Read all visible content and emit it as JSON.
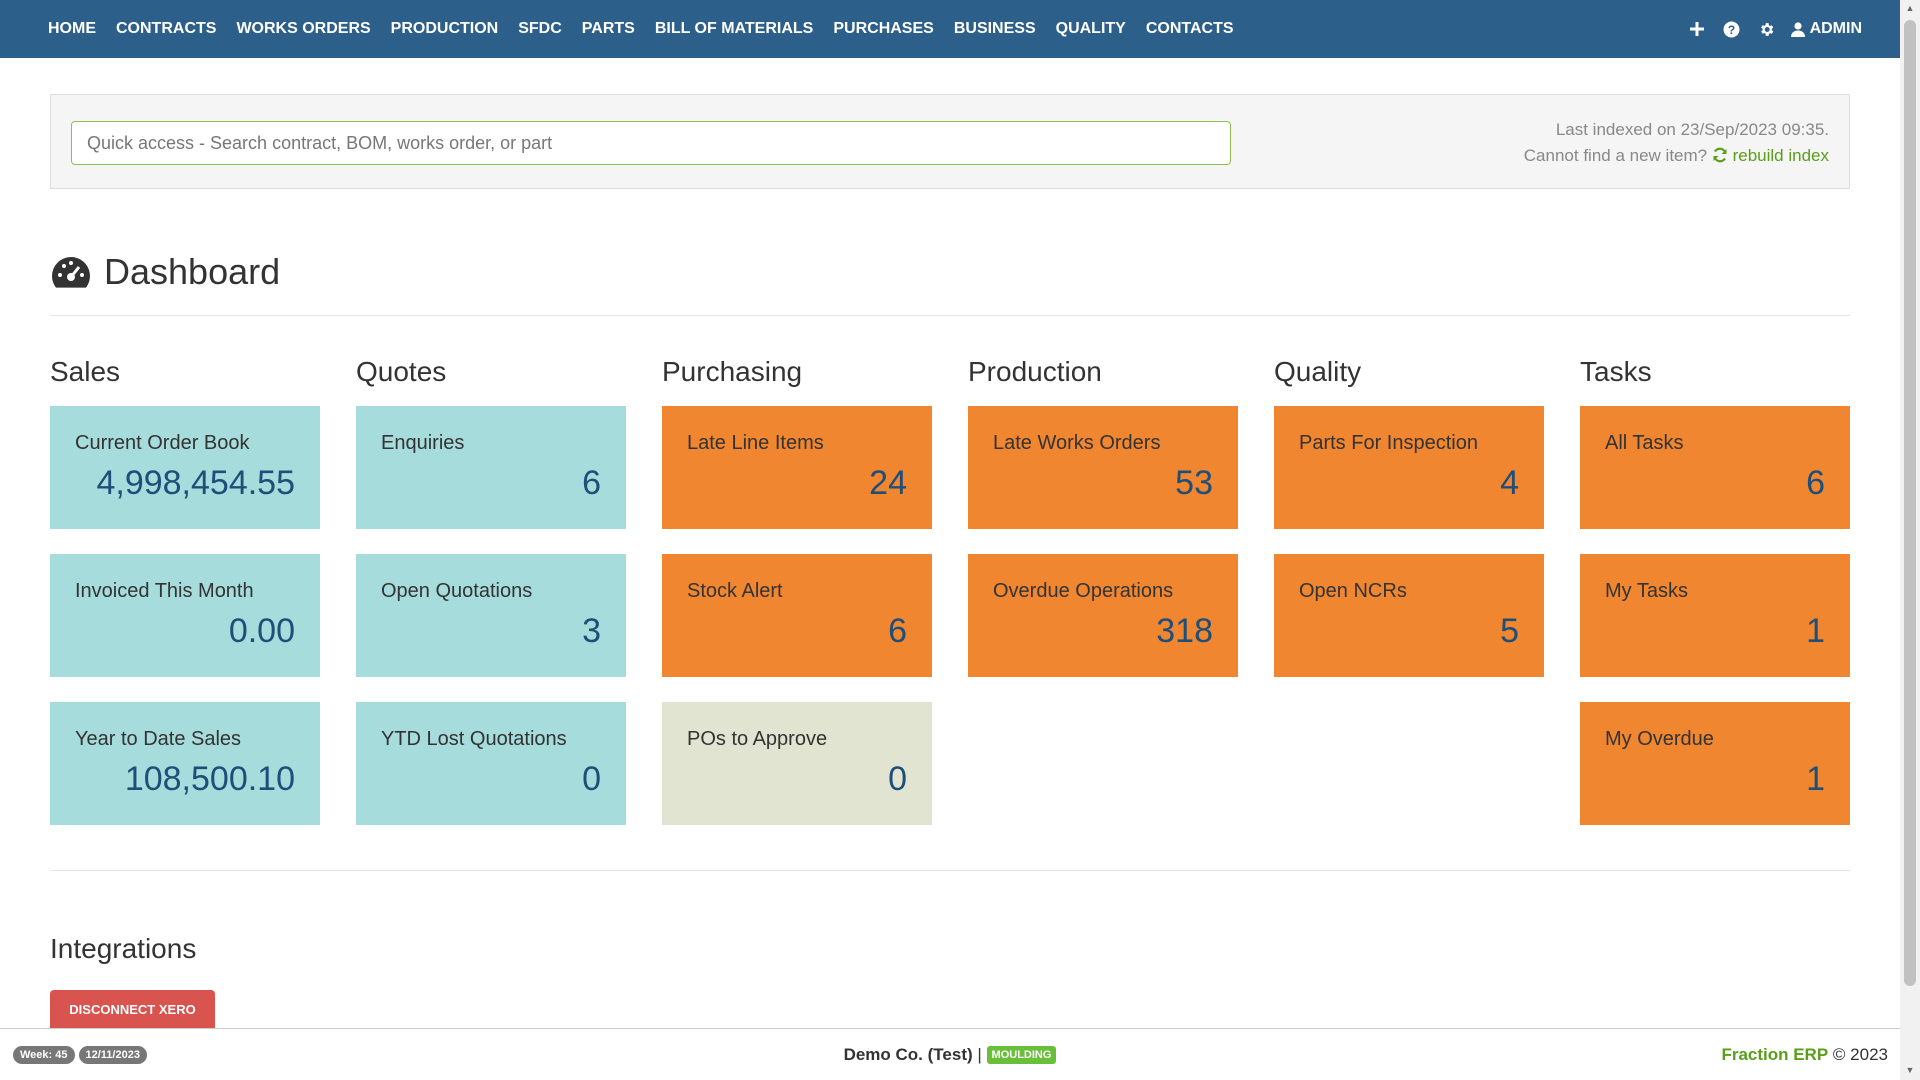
{
  "nav": {
    "items": [
      "HOME",
      "CONTRACTS",
      "WORKS ORDERS",
      "PRODUCTION",
      "SFDC",
      "PARTS",
      "BILL OF MATERIALS",
      "PURCHASES",
      "BUSINESS",
      "QUALITY",
      "CONTACTS"
    ],
    "icons": [
      "plus-icon",
      "help-icon",
      "gear-icon",
      "user-icon"
    ],
    "user": "ADMIN"
  },
  "quick_access": {
    "placeholder": "Quick access - Search contract, BOM, works order, or part",
    "last_indexed": "Last indexed on 23/Sep/2023 09:35.",
    "cannot_find": "Cannot find a new item?",
    "rebuild": "rebuild index"
  },
  "dashboard": {
    "title": "Dashboard",
    "columns": [
      {
        "title": "Sales",
        "tiles": [
          {
            "label": "Current Order Book",
            "value": "4,998,454.55",
            "color": "#a6dcdb"
          },
          {
            "label": "Invoiced This Month",
            "value": "0.00",
            "color": "#a6dcdb"
          },
          {
            "label": "Year to Date Sales",
            "value": "108,500.10",
            "color": "#a6dcdb"
          }
        ]
      },
      {
        "title": "Quotes",
        "tiles": [
          {
            "label": "Enquiries",
            "value": "6",
            "color": "#a6dcdb"
          },
          {
            "label": "Open Quotations",
            "value": "3",
            "color": "#a6dcdb"
          },
          {
            "label": "YTD Lost Quotations",
            "value": "0",
            "color": "#a6dcdb"
          }
        ]
      },
      {
        "title": "Purchasing",
        "tiles": [
          {
            "label": "Late Line Items",
            "value": "24",
            "color": "#f0862f"
          },
          {
            "label": "Stock Alert",
            "value": "6",
            "color": "#f0862f"
          },
          {
            "label": "POs to Approve",
            "value": "0",
            "color": "#e0e4d0"
          }
        ]
      },
      {
        "title": "Production",
        "tiles": [
          {
            "label": "Late Works Orders",
            "value": "53",
            "color": "#f0862f"
          },
          {
            "label": "Overdue Operations",
            "value": "318",
            "color": "#f0862f"
          }
        ]
      },
      {
        "title": "Quality",
        "tiles": [
          {
            "label": "Parts For Inspection",
            "value": "4",
            "color": "#f0862f"
          },
          {
            "label": "Open NCRs",
            "value": "5",
            "color": "#f0862f"
          }
        ]
      },
      {
        "title": "Tasks",
        "tiles": [
          {
            "label": "All Tasks",
            "value": "6",
            "color": "#f0862f"
          },
          {
            "label": "My Tasks",
            "value": "1",
            "color": "#f0862f"
          },
          {
            "label": "My Overdue",
            "value": "1",
            "color": "#f0862f"
          }
        ]
      }
    ]
  },
  "integrations": {
    "title": "Integrations",
    "button": "DISCONNECT XERO"
  },
  "footer": {
    "week": "Week: 45",
    "date": "12/11/2023",
    "company": "Demo Co. (Test)",
    "separator": "|",
    "tag": "MOULDING",
    "brand": "Fraction ERP",
    "copyright": "© 2023"
  }
}
